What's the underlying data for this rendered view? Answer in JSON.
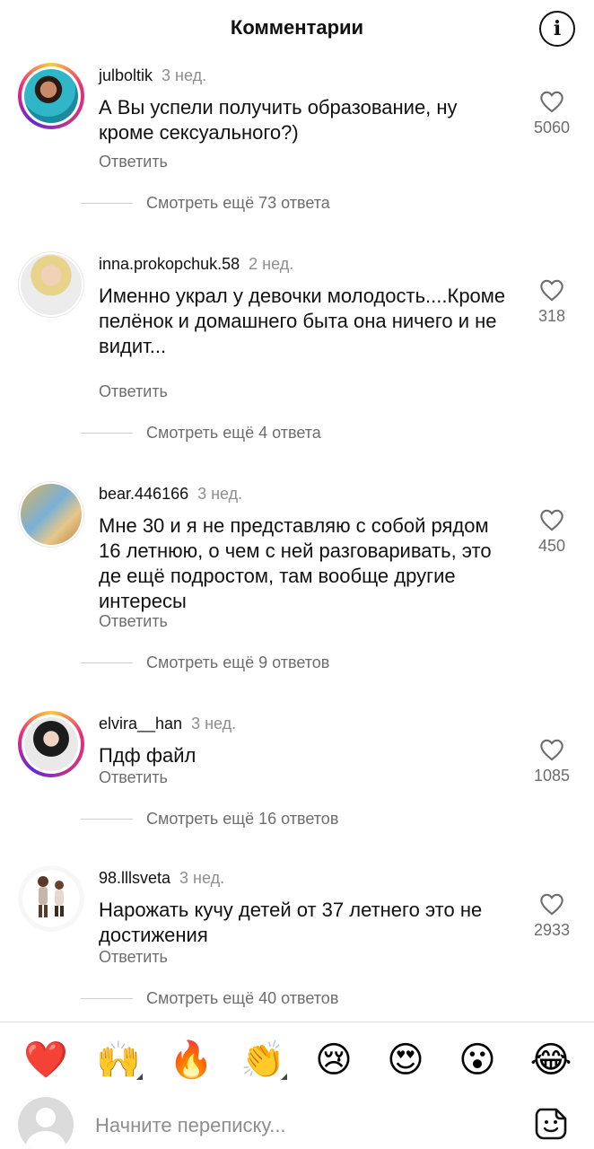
{
  "header": {
    "title": "Комментарии",
    "info_icon": "info-icon",
    "info_glyph": "i"
  },
  "comments": [
    {
      "username": "julboltik",
      "time": "3 нед.",
      "text": "А Вы успели получить образование, ну кроме сексуального?)",
      "reply_label": "Ответить",
      "likes": "5060",
      "more_replies": "Смотреть ещё 73 ответа",
      "avatar_ring": "story"
    },
    {
      "username": "inna.prokopchuk.58",
      "time": "2 нед.",
      "text": "Именно украл у девочки молодость....Кроме пелёнок и домашнего быта она ничего и не видит...",
      "reply_label": "Ответить",
      "likes": "318",
      "more_replies": "Смотреть ещё 4 ответа",
      "avatar_ring": "plain"
    },
    {
      "username": "bear.446166",
      "time": "3 нед.",
      "text": "Мне 30 и я не представляю с собой рядом 16 летнюю, о чем с ней разговаривать, это де ещё подростом, там вообще другие интересы",
      "reply_label": "Ответить",
      "likes": "450",
      "more_replies": "Смотреть ещё 9 ответов",
      "avatar_ring": "plain"
    },
    {
      "username": "elvira__han",
      "time": "3 нед.",
      "text": "Пдф файл",
      "reply_label": "Ответить",
      "likes": "1085",
      "more_replies": "Смотреть ещё 16 ответов",
      "avatar_ring": "story"
    },
    {
      "username": "98.lllsveta",
      "time": "3 нед.",
      "text": "Нарожать  кучу детей от 37 летнего это не достижения",
      "reply_label": "Ответить",
      "likes": "2933",
      "more_replies": "Смотреть ещё 40 ответов",
      "avatar_ring": "none"
    }
  ],
  "reactions": [
    {
      "name": "heart-emoji",
      "glyph": "❤️"
    },
    {
      "name": "raising-hands-emoji",
      "glyph": "🙌"
    },
    {
      "name": "fire-emoji",
      "glyph": "🔥"
    },
    {
      "name": "clapping-hands-emoji",
      "glyph": "👏"
    },
    {
      "name": "crying-face-emoji",
      "glyph": "😢"
    },
    {
      "name": "heart-eyes-emoji",
      "glyph": "😍"
    },
    {
      "name": "surprised-face-emoji",
      "glyph": "😮"
    },
    {
      "name": "tears-of-joy-emoji",
      "glyph": "😂"
    }
  ],
  "composer": {
    "placeholder": "Начните переписку...",
    "sticker_icon": "sticker-icon"
  },
  "colors": {
    "secondary_text": "#6d6d6d",
    "timestamp": "#8e8e8e",
    "divider": "#dbdbdb"
  }
}
